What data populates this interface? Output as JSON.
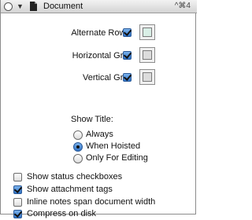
{
  "header": {
    "title": "Document",
    "shortcut": "^⌘4"
  },
  "grid_options": [
    {
      "label": "Alternate Rows:",
      "checked": true,
      "swatch_color": "#d9efe6"
    },
    {
      "label": "Horizontal Grid:",
      "checked": true,
      "swatch_color": "#dcdcdc"
    },
    {
      "label": "Vertical Grid:",
      "checked": true,
      "swatch_color": "#dcdcdc"
    }
  ],
  "show_title": {
    "label": "Show Title:",
    "options": [
      {
        "label": "Always",
        "selected": false
      },
      {
        "label": "When Hoisted",
        "selected": true
      },
      {
        "label": "Only For Editing",
        "selected": false
      }
    ]
  },
  "checkboxes": [
    {
      "label": "Show status checkboxes",
      "checked": false
    },
    {
      "label": "Show attachment tags",
      "checked": true
    },
    {
      "label": "Inline notes span document width",
      "checked": false
    },
    {
      "label": "Compress on disk",
      "checked": true
    }
  ],
  "colors": {
    "accent": "#2f72c6"
  }
}
